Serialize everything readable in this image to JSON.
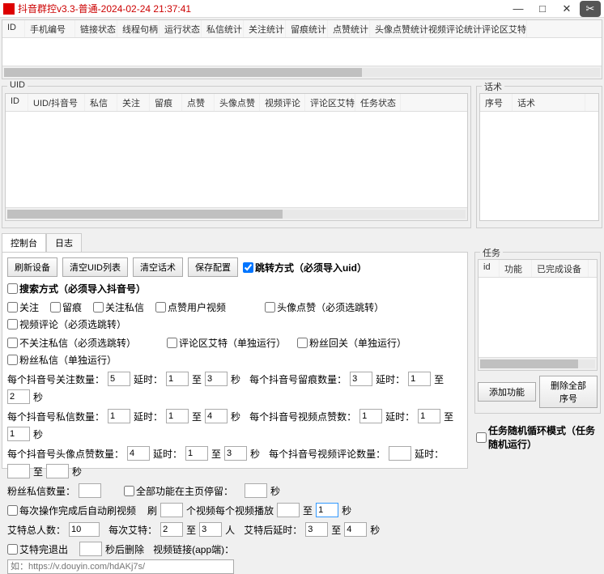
{
  "title": "抖音群控v3.3-普通-2024-02-24 21:37:41",
  "topGrid": {
    "cols": [
      "ID",
      "手机编号",
      "链接状态",
      "线程句柄",
      "运行状态",
      "私信统计",
      "关注统计",
      "留痕统计",
      "点赞统计",
      "头像点赞统计",
      "视频评论统计",
      "评论区艾特"
    ]
  },
  "uidGroup": {
    "label": "UID",
    "cols": [
      "ID",
      "UID/抖音号",
      "私信",
      "关注",
      "留痕",
      "点赞",
      "头像点赞",
      "视频评论",
      "评论区艾特",
      "任务状态"
    ]
  },
  "talkGroup": {
    "label": "话术",
    "cols": [
      "序号",
      "话术"
    ]
  },
  "tabs": {
    "a": "控制台",
    "b": "日志"
  },
  "buttons": {
    "refresh": "刷新设备",
    "clearUid": "清空UID列表",
    "clearTalk": "清空话术",
    "saveCfg": "保存配置",
    "addFn": "添加功能",
    "delAll": "删除全部序号"
  },
  "modes": {
    "jump": "跳转方式（必须导入uid）",
    "search": "搜索方式（必须导入抖音号）"
  },
  "chk": {
    "follow": "关注",
    "leave": "留痕",
    "followPm": "关注私信",
    "likeVideo": "点赞用户视频",
    "avatarLike": "头像点赞（必须选跳转）",
    "videoComment": "视频评论（必须选跳转）",
    "unfollowPm": "不关注私信（必须选跳转）",
    "commentAt": "评论区艾特（单独运行）",
    "fanBack": "粉丝回关（单独运行）",
    "fanPm": "粉丝私信（单独运行）",
    "allHome": "全部功能在主页停留：",
    "autoRefresh": "每次操作完成后自动刷视频",
    "atDone": "艾特完退出",
    "taskLoop": "任务随机循环模式（任务随机运行）"
  },
  "lbl": {
    "followCnt": "每个抖音号关注数量：",
    "delay": "延时：",
    "to": "至",
    "sec": "秒",
    "leaveCnt": "每个抖音号留痕数量：",
    "pmCnt": "每个抖音号私信数量：",
    "videoLikeCnt": "每个抖音号视频点赞数：",
    "avatarLikeCnt": "每个抖音号头像点赞数量：",
    "videoCommentCnt": "每个抖音号视频评论数量：",
    "fanPmCnt": "粉丝私信数量：",
    "refresh": "刷",
    "videoEach": "个视频每个视频播放",
    "atTotal": "艾特总人数：",
    "atEach": "每次艾特：",
    "person": "人",
    "atDelay": "艾特后延时：",
    "secDel": "秒后删除",
    "videoLink": "视频链接(app端)："
  },
  "vals": {
    "followCnt": "5",
    "d1a": "1",
    "d1b": "3",
    "leaveCnt": "3",
    "d2a": "1",
    "d2b": "2",
    "pmCnt": "1",
    "d3a": "1",
    "d3b": "4",
    "videoLikeCnt": "1",
    "d4a": "1",
    "d4b": "1",
    "avatarLikeCnt": "4",
    "d5a": "1",
    "d5b": "3",
    "videoCommentCnt": "",
    "d6a": "",
    "d6b": "",
    "fanPmCnt": "",
    "homeStay": "",
    "refreshN": "",
    "playA": "",
    "playB": "1",
    "atTotal": "10",
    "atEach": "2",
    "atEachB": "3",
    "atDelayA": "3",
    "atDelayB": "4",
    "secDel": "",
    "videoLink": "如：https://v.douyin.com/hdAKj7s/"
  },
  "taskPanel": {
    "label": "任务",
    "cols": [
      "id",
      "功能",
      "已完成设备"
    ]
  }
}
